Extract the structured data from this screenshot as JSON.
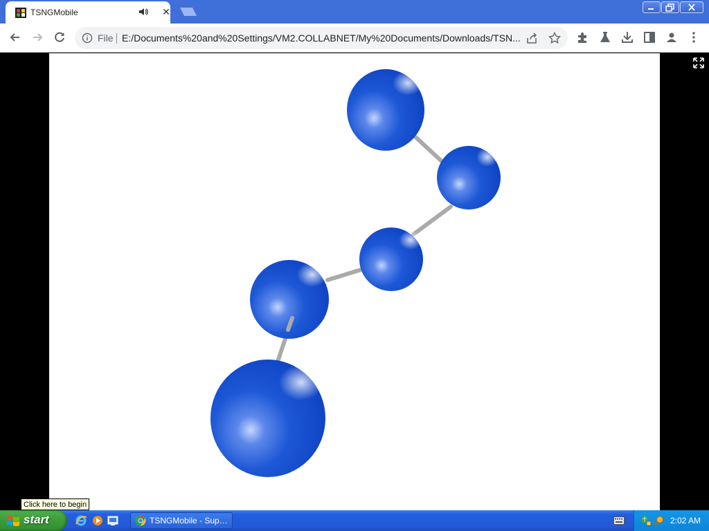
{
  "tab": {
    "title": "TSNGMobile",
    "close_glyph": "✕",
    "favicon": "filmstrip-icon",
    "audio": "speaker-icon"
  },
  "window_controls": [
    "minimize-icon",
    "restore-icon",
    "close-icon"
  ],
  "toolbar": {
    "back": "arrow-left-icon",
    "forward": "arrow-right-icon",
    "reload": "reload-icon",
    "scheme_label": "File",
    "url": "E:/Documents%20and%20Settings/VM2.COLLABNET/My%20Documents/Downloads/TSN...",
    "right_icons": [
      "share-icon",
      "star-icon",
      "extensions-icon",
      "labs-icon",
      "download-icon",
      "side-panel-icon",
      "profile-icon",
      "menu-icon"
    ]
  },
  "content": {
    "tooltip": "Click here to begin",
    "molecule_color": "#1651d8",
    "bond_color": "#a9a9a9"
  },
  "taskbar": {
    "start_label": "start",
    "quick_launch": [
      "internet-explorer-icon",
      "media-player-icon",
      "show-desktop-icon"
    ],
    "task_label": "TSNGMobile - Super...",
    "clock": "2:02 AM"
  }
}
